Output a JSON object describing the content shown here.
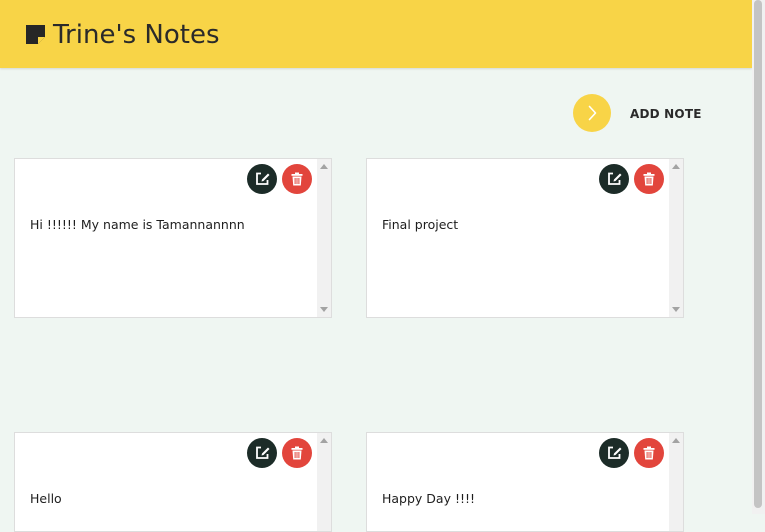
{
  "header": {
    "title": "Trine's Notes",
    "logo_icon": "sticky-note-icon",
    "background_color": "#f8d447"
  },
  "toolbar": {
    "add_note_icon": "chevron-right-icon",
    "add_note_label": "ADD NOTE"
  },
  "notes": [
    {
      "text": "Hi !!!!!! My name is Tamannannnn"
    },
    {
      "text": "Final project"
    },
    {
      "text": "Hello"
    },
    {
      "text": "Happy Day !!!!"
    }
  ],
  "note_actions": {
    "edit_icon": "edit-icon",
    "delete_icon": "trash-icon",
    "edit_color": "#1c2c28",
    "delete_color": "#e2453c"
  },
  "colors": {
    "page_background": "#eff6f2",
    "accent": "#f8d447"
  }
}
